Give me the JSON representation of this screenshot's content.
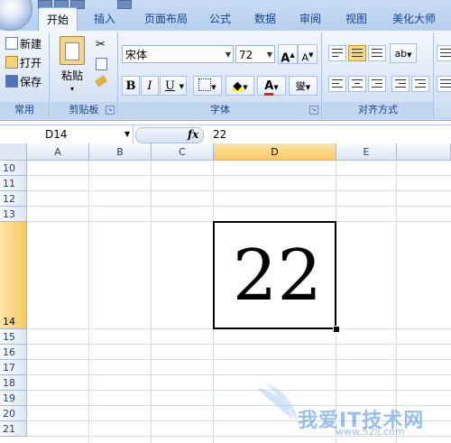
{
  "tabs": [
    {
      "label": "开始",
      "active": true
    },
    {
      "label": "插入",
      "active": false
    },
    {
      "label": "页面布局",
      "active": false
    },
    {
      "label": "公式",
      "active": false
    },
    {
      "label": "数据",
      "active": false
    },
    {
      "label": "审阅",
      "active": false
    },
    {
      "label": "视图",
      "active": false
    },
    {
      "label": "美化大师",
      "active": false
    }
  ],
  "groups": {
    "common": {
      "label": "常用",
      "new": "新建",
      "open": "打开",
      "save": "保存"
    },
    "clipboard": {
      "label": "剪贴板",
      "paste": "粘贴"
    },
    "font": {
      "label": "字体",
      "name": "宋体",
      "size": "72",
      "bold": "B",
      "italic": "I",
      "underline": "U",
      "grow": "A",
      "shrink": "A",
      "wen": "燮"
    },
    "align": {
      "label": "对齐方式"
    }
  },
  "formula_bar": {
    "name_box": "D14",
    "fx": "fx",
    "value": "22"
  },
  "columns": [
    {
      "label": "A",
      "selected": false
    },
    {
      "label": "B",
      "selected": false
    },
    {
      "label": "C",
      "selected": false
    },
    {
      "label": "D",
      "selected": true
    },
    {
      "label": "E",
      "selected": false
    }
  ],
  "rows": [
    {
      "label": "10",
      "selected": false
    },
    {
      "label": "11",
      "selected": false
    },
    {
      "label": "12",
      "selected": false
    },
    {
      "label": "13",
      "selected": false
    },
    {
      "label": "14",
      "selected": true
    },
    {
      "label": "15",
      "selected": false
    },
    {
      "label": "16",
      "selected": false
    },
    {
      "label": "17",
      "selected": false
    },
    {
      "label": "18",
      "selected": false
    },
    {
      "label": "19",
      "selected": false
    },
    {
      "label": "20",
      "selected": false
    },
    {
      "label": "21",
      "selected": false
    }
  ],
  "active_cell": {
    "ref": "D14",
    "value": "22"
  },
  "watermark": {
    "text": "我爱IT技术网",
    "url": "www.52ij.com"
  },
  "colors": {
    "accent": "#15428b",
    "selected_header": "#f8c85f",
    "ribbon": "#dde8f6",
    "font_color": "#e02020",
    "highlight": "#ffff00"
  }
}
